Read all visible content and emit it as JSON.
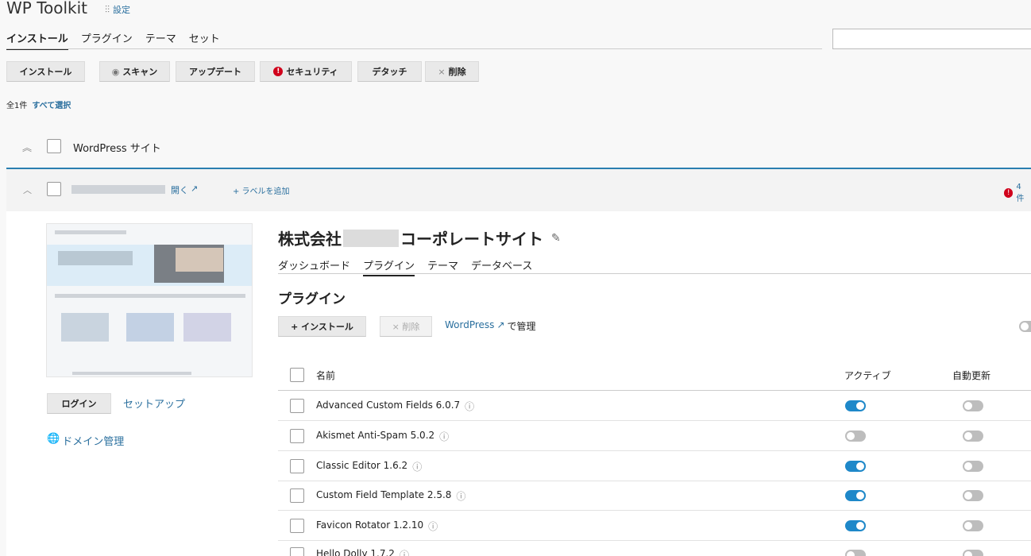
{
  "app": {
    "title": "WP Toolkit",
    "settings_label": "設定"
  },
  "top_tabs": [
    {
      "label": "インストール",
      "active": true
    },
    {
      "label": "プラグイン"
    },
    {
      "label": "テーマ"
    },
    {
      "label": "セット"
    }
  ],
  "search": {
    "value": "",
    "placeholder": ""
  },
  "toolbar": {
    "install": "インストール",
    "scan": "スキャン",
    "update": "アップデート",
    "security": "セキュリティ",
    "detach": "デタッチ",
    "delete": "削除"
  },
  "summary": {
    "count": "全1件",
    "select_all": "すべて選択"
  },
  "group": {
    "label": "WordPress サイト"
  },
  "site": {
    "open_label": "開く",
    "add_label": "+ ラベルを追加",
    "issues": "4 件",
    "title_prefix": "株式会社",
    "title_suffix": "コーポレートサイト",
    "tabs": [
      {
        "label": "ダッシュボード"
      },
      {
        "label": "プラグイン",
        "active": true
      },
      {
        "label": "テーマ"
      },
      {
        "label": "データベース"
      }
    ],
    "login_button": "ログイン",
    "setup_link": "セットアップ",
    "domain_link": "ドメイン管理"
  },
  "plugins": {
    "heading": "プラグイン",
    "install_button": "+ インストール",
    "delete_button": "× 削除",
    "manage_link": "WordPress",
    "manage_suffix": "で管理",
    "columns": {
      "name": "名前",
      "active": "アクティブ",
      "autoupdate": "自動更新"
    },
    "rows": [
      {
        "name": "Advanced Custom Fields 6.0.7",
        "active": true,
        "autoupdate": false
      },
      {
        "name": "Akismet Anti-Spam 5.0.2",
        "active": false,
        "autoupdate": false
      },
      {
        "name": "Classic Editor 1.6.2",
        "active": true,
        "autoupdate": false
      },
      {
        "name": "Custom Field Template 2.5.8",
        "active": true,
        "autoupdate": false
      },
      {
        "name": "Favicon Rotator 1.2.10",
        "active": true,
        "autoupdate": false
      },
      {
        "name": "Hello Dolly 1.7.2",
        "active": false,
        "autoupdate": false
      }
    ]
  },
  "colors": {
    "accent": "#1e88c9",
    "link": "#2a6f9e",
    "danger": "#d0021b"
  }
}
